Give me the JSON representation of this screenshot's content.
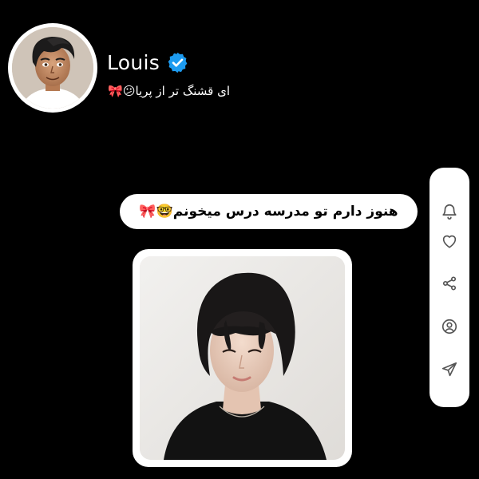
{
  "profile": {
    "username": "Louis",
    "verified": true,
    "bio": "ای قشنگ تر از پریا😕🎀",
    "avatar_icon": "cartoon-avatar-icon",
    "verified_icon": "verified-badge-icon"
  },
  "post": {
    "caption": "هنوز دارم تو مدرسه درس میخونم🤓🎀",
    "photo_alt": "photo"
  },
  "actions": [
    {
      "name": "notification",
      "icon": "bell-icon"
    },
    {
      "name": "like",
      "icon": "heart-icon"
    },
    {
      "name": "share",
      "icon": "share-icon"
    },
    {
      "name": "profile",
      "icon": "user-icon"
    },
    {
      "name": "send",
      "icon": "send-icon"
    }
  ],
  "colors": {
    "background": "#000000",
    "card": "#ffffff",
    "verified_blue": "#1d9bf0",
    "text_light": "#ffffff",
    "text_dark": "#000000",
    "icon_gray": "#555555"
  }
}
